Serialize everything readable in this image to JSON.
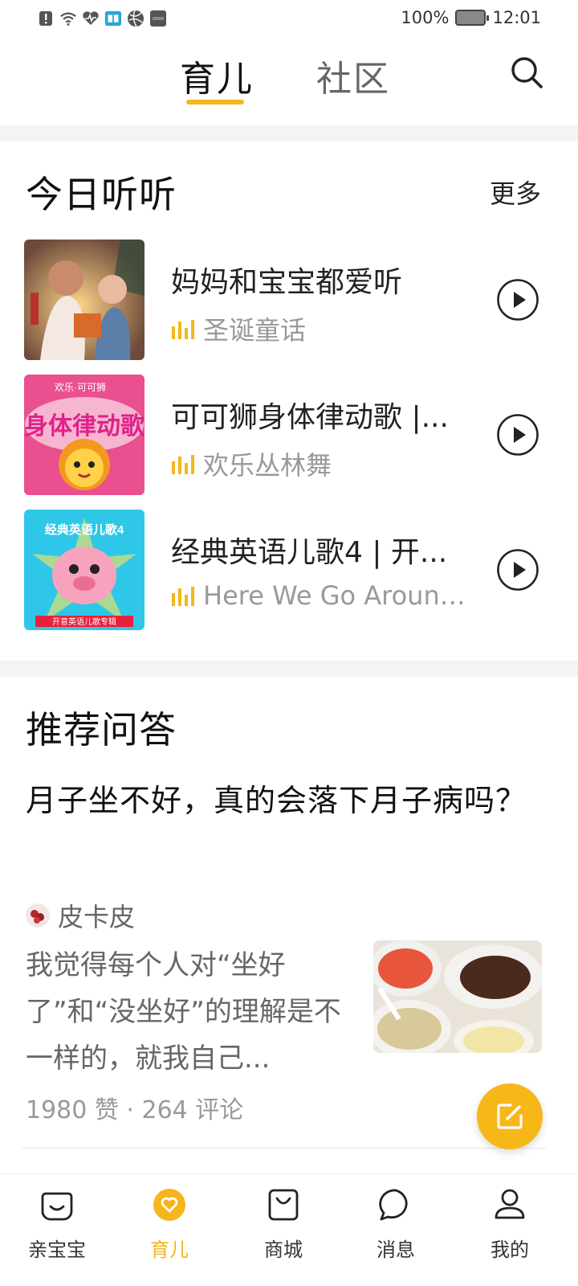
{
  "status_bar": {
    "battery": "100%",
    "time": "12:01"
  },
  "top_tabs": [
    {
      "label": "育儿",
      "active": true
    },
    {
      "label": "社区",
      "active": false
    }
  ],
  "listen": {
    "title": "今日听听",
    "more": "更多",
    "tracks": [
      {
        "title": "妈妈和宝宝都爱听",
        "subtitle": "圣诞童话"
      },
      {
        "title": "可可狮身体律动歌 |...",
        "subtitle": "欢乐丛林舞"
      },
      {
        "title": "经典英语儿歌4 | 开...",
        "subtitle": "Here We Go Around..."
      }
    ],
    "cover_texts": {
      "cover2_banner": "身体律动歌",
      "cover2_tag": "欢乐·可可狮",
      "cover3_top": "经典英语儿歌4",
      "cover3_bottom": "开意英语儿歌专辑"
    }
  },
  "qa": {
    "section_title": "推荐问答",
    "question": "月子坐不好，真的会落下月子病吗？",
    "author": "皮卡皮",
    "excerpt": "我觉得每个人对“坐好了”和“没坐好”的理解是不一样的，就我自己...",
    "stats": "1980 赞 · 264 评论"
  },
  "bottom_nav": [
    {
      "label": "亲宝宝",
      "icon": "baby-face-icon",
      "active": false
    },
    {
      "label": "育儿",
      "icon": "heart-icon",
      "active": true
    },
    {
      "label": "商城",
      "icon": "shopping-bag-icon",
      "active": false
    },
    {
      "label": "消息",
      "icon": "chat-bubble-icon",
      "active": false
    },
    {
      "label": "我的",
      "icon": "profile-icon",
      "active": false
    }
  ],
  "colors": {
    "accent": "#f5b51c",
    "text_primary": "#222222",
    "text_secondary": "#999999",
    "divider": "#f4f4f4"
  }
}
